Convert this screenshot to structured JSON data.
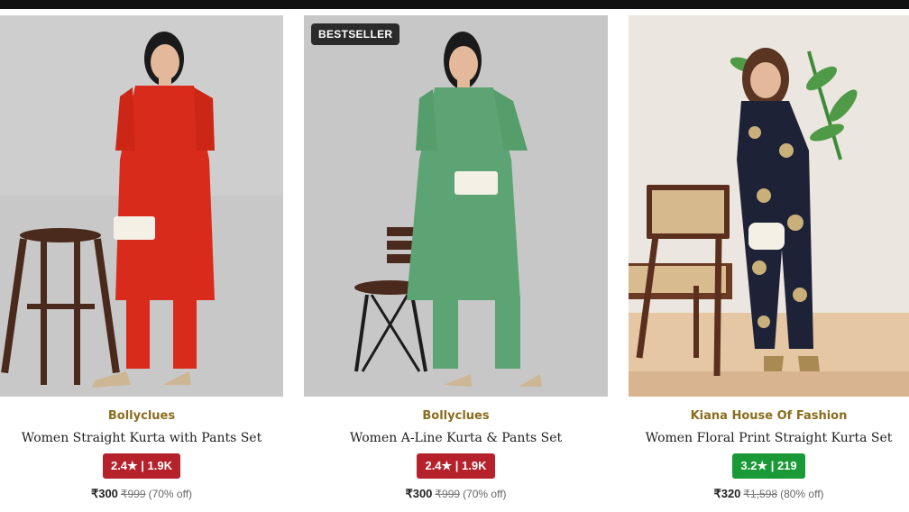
{
  "products": [
    {
      "badge": "",
      "brand": "Bollyclues",
      "title": "Women Straight Kurta with Pants Set",
      "rating": "2.4★ | 1.9K",
      "rating_color": "#b5222b",
      "price": "₹300",
      "mrp": "₹999",
      "discount": "(70% off)",
      "outfit_color": "#d92b1c"
    },
    {
      "badge": "BESTSELLER",
      "brand": "Bollyclues",
      "title": "Women A-Line Kurta & Pants Set",
      "rating": "2.4★ | 1.9K",
      "rating_color": "#b5222b",
      "price": "₹300",
      "mrp": "₹999",
      "discount": "(70% off)",
      "outfit_color": "#5ca474"
    },
    {
      "badge": "",
      "brand": "Kiana House Of Fashion",
      "title": "Women Floral Print Straight Kurta Set",
      "rating": "3.2★ | 219",
      "rating_color": "#1a9a37",
      "price": "₹320",
      "mrp": "₹1,598",
      "discount": "(80% off)",
      "outfit_color": "#1d2236"
    }
  ]
}
